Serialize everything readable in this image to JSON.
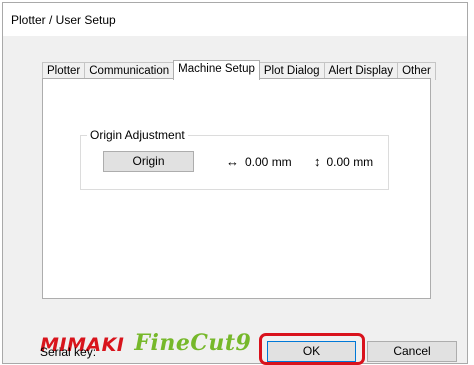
{
  "window": {
    "title": "Plotter / User Setup"
  },
  "tabs": [
    {
      "label": "Plotter",
      "active": false
    },
    {
      "label": "Communication",
      "active": false
    },
    {
      "label": "Machine Setup",
      "active": true
    },
    {
      "label": "Plot Dialog",
      "active": false
    },
    {
      "label": "Alert Display",
      "active": false
    },
    {
      "label": "Other",
      "active": false
    }
  ],
  "origin_adjustment": {
    "group_label": "Origin Adjustment",
    "origin_button": "Origin",
    "x_glyph": "↔",
    "x_value": "0.00 mm",
    "y_glyph": "↕",
    "y_value": "0.00 mm"
  },
  "branding": {
    "mimaki": "MIMAKI",
    "product": "FineCut9",
    "mimaki_color": "#d8141c",
    "product_color": "#76b82a"
  },
  "footer": {
    "serial_label": "Serial key:",
    "ok_label": "OK",
    "cancel_label": "Cancel"
  },
  "highlight": {
    "color": "#d9121c",
    "target": "ok-button"
  }
}
